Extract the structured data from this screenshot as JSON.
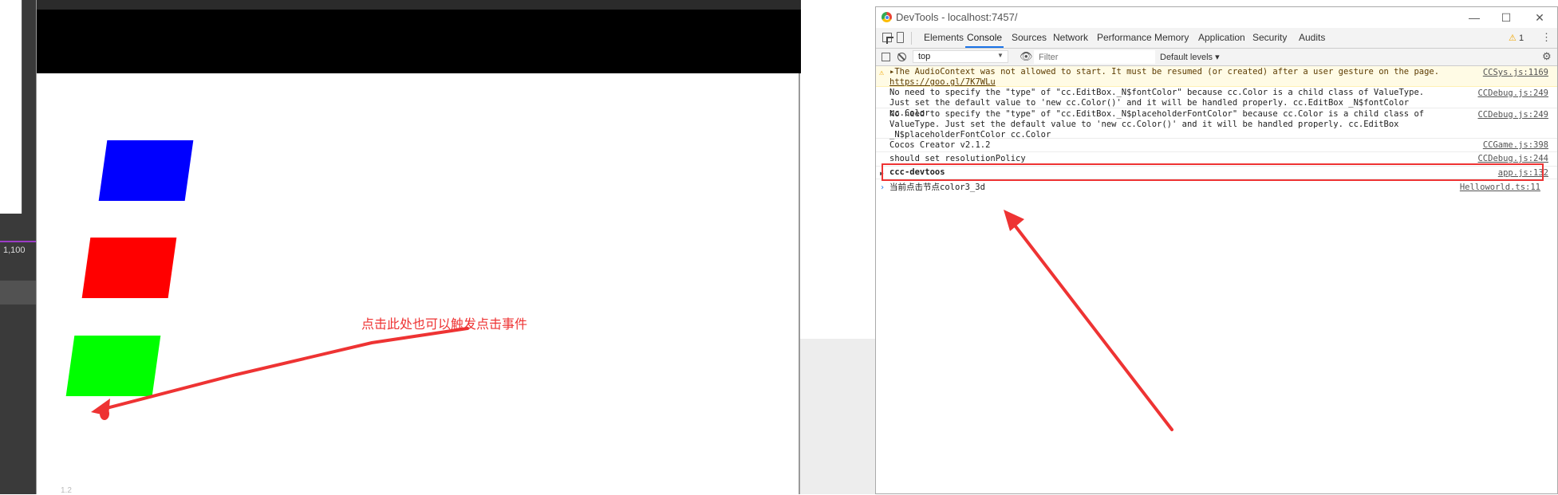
{
  "left_strip": {
    "ruler_label": "1,100"
  },
  "game": {
    "annotation": "点击此处也可以触发点击事件",
    "corner_text": "1.2",
    "colors": {
      "blue": "#0000ff",
      "red": "#ff0000",
      "green": "#00ff00",
      "annotation": "#ee3333"
    }
  },
  "devtools": {
    "title": "DevTools - localhost:7457/",
    "window_buttons": {
      "minimize": "—",
      "maximize": "☐",
      "close": "✕"
    },
    "tabs": [
      {
        "label": "Elements",
        "active": false
      },
      {
        "label": "Console",
        "active": true
      },
      {
        "label": "Sources",
        "active": false
      },
      {
        "label": "Network",
        "active": false
      },
      {
        "label": "Performance",
        "active": false
      },
      {
        "label": "Memory",
        "active": false
      },
      {
        "label": "Application",
        "active": false
      },
      {
        "label": "Security",
        "active": false
      },
      {
        "label": "Audits",
        "active": false
      }
    ],
    "warning_count": "1",
    "console_bar": {
      "context": "top",
      "filter_placeholder": "Filter",
      "levels": "Default levels ▾"
    },
    "log": [
      {
        "type": "warning",
        "message_prefix": "▸The AudioContext was not allowed to start. It must be resumed (or created) after a user gesture on the page. ",
        "message_link": "https://goo.gl/7K7WLu",
        "source": "CCSys.js:1169"
      },
      {
        "type": "log",
        "message": "No need to specify the \"type\" of \"cc.EditBox._N$fontColor\" because cc.Color is a child class of ValueType. Just set the default value to 'new cc.Color()' and it will be handled properly. cc.EditBox _N$fontColor cc.Color",
        "source": "CCDebug.js:249"
      },
      {
        "type": "log",
        "message": "No need to specify the \"type\" of \"cc.EditBox._N$placeholderFontColor\" because cc.Color is a child class of ValueType. Just set the default value to 'new cc.Color()' and it will be handled properly. cc.EditBox _N$placeholderFontColor cc.Color",
        "source": "CCDebug.js:249"
      },
      {
        "type": "log",
        "message": "Cocos Creator v2.1.2",
        "source": "CCGame.js:398"
      },
      {
        "type": "log",
        "message": "should set resolutionPolicy",
        "source": "CCDebug.js:244"
      },
      {
        "type": "group",
        "message": "ccc-devtoos",
        "source": "app.js:132"
      },
      {
        "type": "log",
        "message": "当前点击节点color3_3d",
        "source": "Helloworld.ts:11"
      }
    ],
    "prompt": "›"
  }
}
